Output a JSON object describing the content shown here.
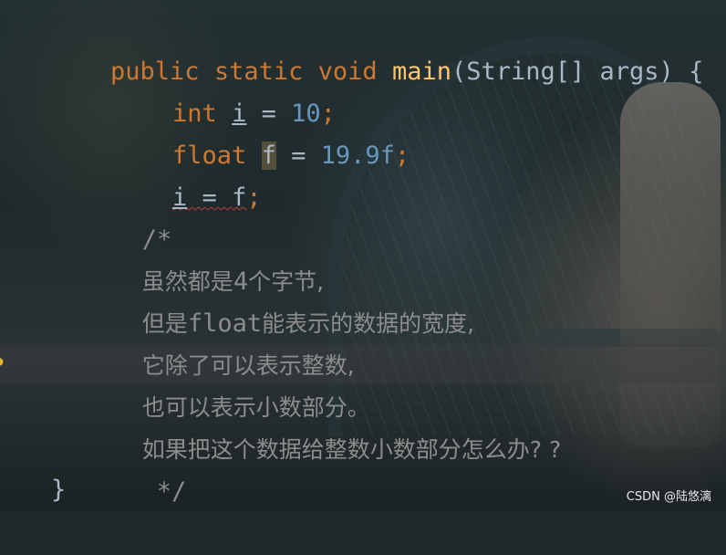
{
  "editor": {
    "line1": {
      "kw_public": "public",
      "kw_static": "static",
      "kw_void": "void",
      "method": "main",
      "rest": "(String[] args) {"
    },
    "line2": {
      "type": "int",
      "var": "i",
      "op": " = ",
      "value": "10",
      "semi": ";"
    },
    "line3": {
      "type": "float",
      "var": "f",
      "op": " = ",
      "value": "19.9f",
      "semi": ";"
    },
    "line4": {
      "var": "i",
      "op": " = ",
      "value": "f",
      "semi": ";"
    },
    "comment": {
      "open": "/*",
      "l1_a": "虽然都是",
      "l1_num": "4",
      "l1_b": "个字节,",
      "l2_a": "但是",
      "l2_code": "float",
      "l2_b": "能表示的数据的宽度,",
      "l3": "它除了可以表示整数,",
      "l4": "也可以表示小数部分。",
      "l5": "如果把这个数据给整数小数部分怎么办? ?",
      "close": "*/"
    },
    "closing_brace": "}"
  },
  "watermark": "CSDN @陆悠漓",
  "icons": {
    "gutter": "lightbulb-icon"
  },
  "colors": {
    "keyword": "#cc7832",
    "method": "#ffc66d",
    "number": "#6897bb",
    "text": "#a9b7c6",
    "comment": "#8c8c8c"
  }
}
